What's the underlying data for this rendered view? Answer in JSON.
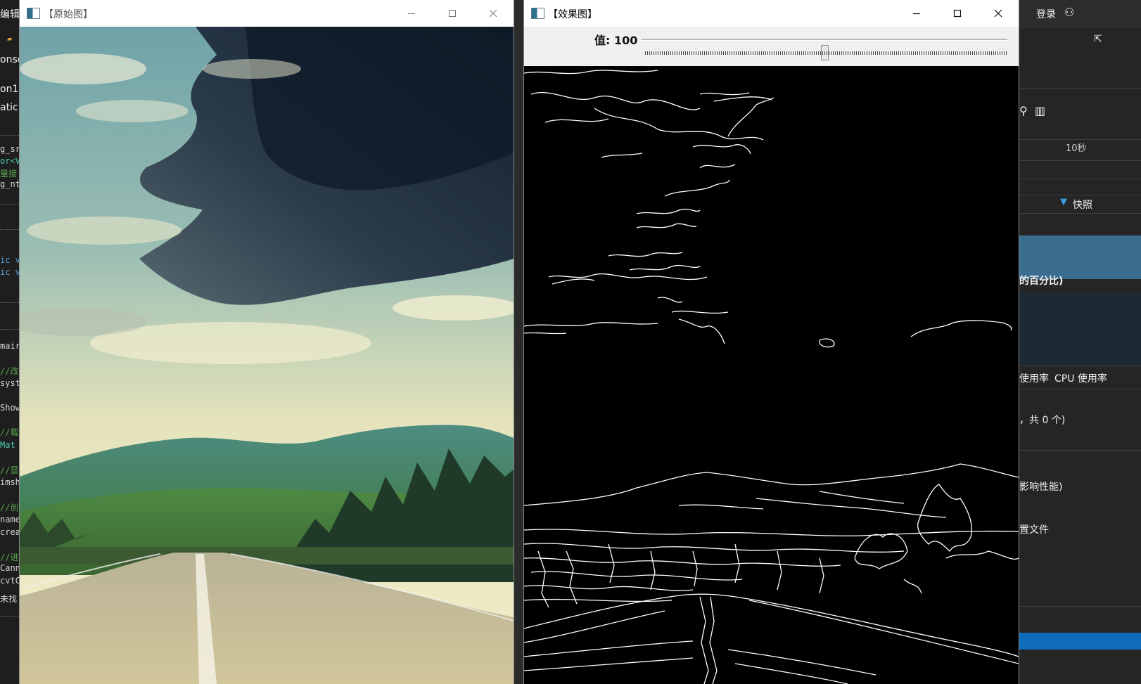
{
  "ide": {
    "left_fragments": {
      "menu": "编辑(E",
      "row1": "onso",
      "row2": "on1",
      "row3": "atic",
      "code": [
        {
          "text": "g_sr",
          "cls": ""
        },
        {
          "text": "or<V",
          "cls": "c-teal"
        },
        {
          "text": "量接",
          "cls": "c-green"
        },
        {
          "text": "g_nt",
          "cls": ""
        },
        {
          "text": "ic v",
          "cls": "c-blue"
        },
        {
          "text": "ic v",
          "cls": "c-blue"
        },
        {
          "text": "mair",
          "cls": ""
        },
        {
          "text": "//改",
          "cls": "c-green"
        },
        {
          "text": "syst",
          "cls": ""
        },
        {
          "text": "Show",
          "cls": ""
        },
        {
          "text": "//载",
          "cls": "c-green"
        },
        {
          "text": "Mat",
          "cls": "c-teal"
        },
        {
          "text": "//显",
          "cls": "c-green"
        },
        {
          "text": "imsh",
          "cls": ""
        },
        {
          "text": "//创",
          "cls": "c-green"
        },
        {
          "text": "name",
          "cls": ""
        },
        {
          "text": "crea",
          "cls": ""
        },
        {
          "text": "//进",
          "cls": "c-green"
        },
        {
          "text": "Cann",
          "cls": ""
        },
        {
          "text": "cvtC",
          "cls": ""
        },
        {
          "text": "未找",
          "cls": ""
        }
      ]
    },
    "right_panel": {
      "login": "登录",
      "timeline_label": "10秒",
      "snapshot_label": "快照",
      "percent_label": "的百分比)",
      "usage_label": "使用率",
      "cpu_label": "CPU 使用率",
      "count_label": "，共 0 个)",
      "perf_label": "影响性能)",
      "file_label": "置文件"
    }
  },
  "windows": {
    "original": {
      "title": "【原始图】",
      "image_desc": "road-landscape-photo"
    },
    "result": {
      "title": "【效果图】",
      "trackbar": {
        "label": "值: 100",
        "value": 100,
        "fraction": 0.5
      },
      "image_desc": "canny-edge-output"
    }
  },
  "colors": {
    "ide_bg": "#1e1e1e",
    "window_bg": "#ffffff",
    "trackbar_bg": "#f0f0f0",
    "edge_bg": "#000000",
    "accent": "#0f6cbd"
  }
}
